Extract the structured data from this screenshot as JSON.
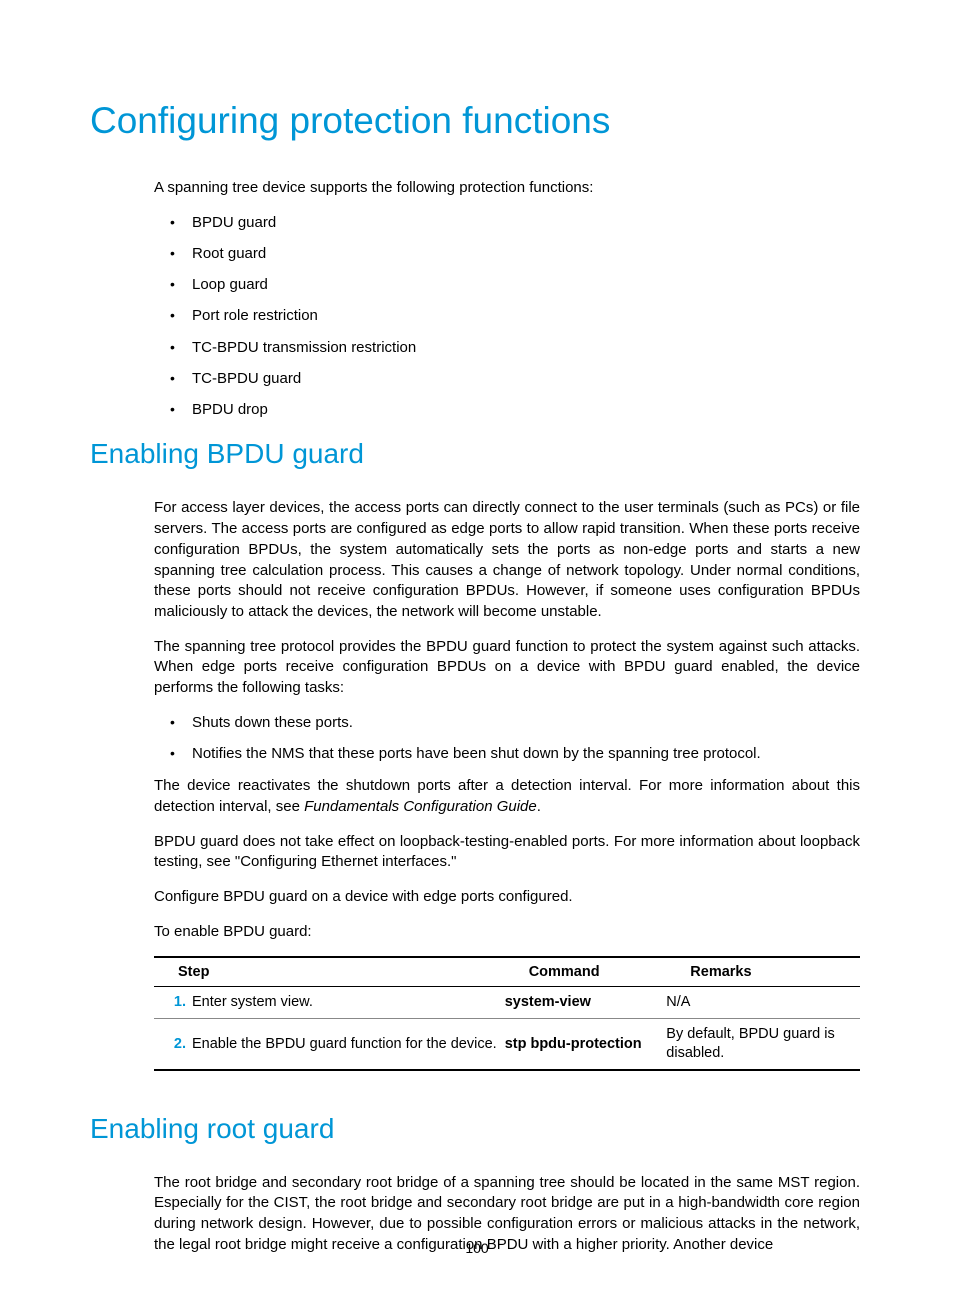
{
  "page_number": "100",
  "h1": "Configuring protection functions",
  "intro": "A spanning tree device supports the following protection functions:",
  "functions": [
    "BPDU guard",
    "Root guard",
    "Loop guard",
    "Port role restriction",
    "TC-BPDU transmission restriction",
    "TC-BPDU guard",
    "BPDU drop"
  ],
  "section_bpdu": {
    "title": "Enabling BPDU guard",
    "p1": "For access layer devices, the access ports can directly connect to the user terminals (such as PCs) or file servers. The access ports are configured as edge ports to allow rapid transition. When these ports receive configuration BPDUs, the system automatically sets the ports as non-edge ports and starts a new spanning tree calculation process. This causes a change of network topology. Under normal conditions, these ports should not receive configuration BPDUs. However, if someone uses configuration BPDUs maliciously to attack the devices, the network will become unstable.",
    "p2": "The spanning tree protocol provides the BPDU guard function to protect the system against such attacks. When edge ports receive configuration BPDUs on a device with BPDU guard enabled, the device performs the following tasks:",
    "tasks": [
      "Shuts down these ports.",
      "Notifies the NMS that these ports have been shut down by the spanning tree protocol."
    ],
    "p3_a": "The device reactivates the shutdown ports after a detection interval. For more information about this detection interval, see ",
    "p3_b": "Fundamentals Configuration Guide",
    "p3_c": ".",
    "p4": "BPDU guard does not take effect on loopback-testing-enabled ports. For more information about loopback testing, see \"Configuring Ethernet interfaces.\"",
    "p5": "Configure BPDU guard on a device with edge ports configured.",
    "p6": "To enable BPDU guard:"
  },
  "table": {
    "headers": {
      "step": "Step",
      "command": "Command",
      "remarks": "Remarks"
    },
    "rows": [
      {
        "num": "1.",
        "step": "Enter system view.",
        "command": "system-view",
        "remarks": "N/A"
      },
      {
        "num": "2.",
        "step": "Enable the BPDU guard function for the device.",
        "command": "stp bpdu-protection",
        "remarks": "By default, BPDU guard is disabled."
      }
    ]
  },
  "section_root": {
    "title": "Enabling root guard",
    "p1": "The root bridge and secondary root bridge of a spanning tree should be located in the same MST region. Especially for the CIST, the root bridge and secondary root bridge are put in a high-bandwidth core region during network design. However, due to possible configuration errors or malicious attacks in the network, the legal root bridge might receive a configuration BPDU with a higher priority. Another device"
  }
}
